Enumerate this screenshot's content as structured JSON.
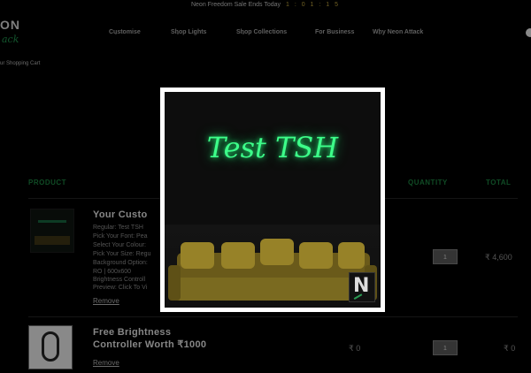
{
  "announcement": {
    "text": "Neon Freedom Sale Ends Today",
    "countdown": "1 : 0 1 : 1 5"
  },
  "logo": {
    "line1": "ON",
    "line2": "ack"
  },
  "nav": {
    "items": [
      {
        "label": "Customise",
        "has_dropdown": true
      },
      {
        "label": "Shop Lights",
        "has_dropdown": true
      },
      {
        "label": "Shop Collections",
        "has_dropdown": true
      },
      {
        "label": "For Business",
        "has_dropdown": false
      },
      {
        "label": "Why Neon Attack",
        "has_dropdown": true
      }
    ]
  },
  "breadcrumb": "ur Shopping Cart",
  "table": {
    "col_product": "PRODUCT",
    "col_quantity": "QUANTITY",
    "col_total": "TOTAL"
  },
  "items": [
    {
      "title": "Your Custo",
      "options": [
        "Regular: Test TSH",
        "Pick Your Font: Pea",
        "Select Your Colour:",
        "Pick Your Size: Regu",
        "Background Option:",
        "RO | 600x600",
        "Brightness Controll",
        "Preview: Click To Vi"
      ],
      "remove": "Remove",
      "quantity": "1",
      "total": "₹ 4,600"
    },
    {
      "title_line1": "Free Brightness",
      "title_line2": "Controller Worth ₹1000",
      "remove": "Remove",
      "unit_price": "₹ 0",
      "quantity": "1",
      "total": "₹ 0"
    }
  ],
  "modal": {
    "neon_text": "Test TSH",
    "badge": "N",
    "neon_color": "#3dff8a"
  }
}
